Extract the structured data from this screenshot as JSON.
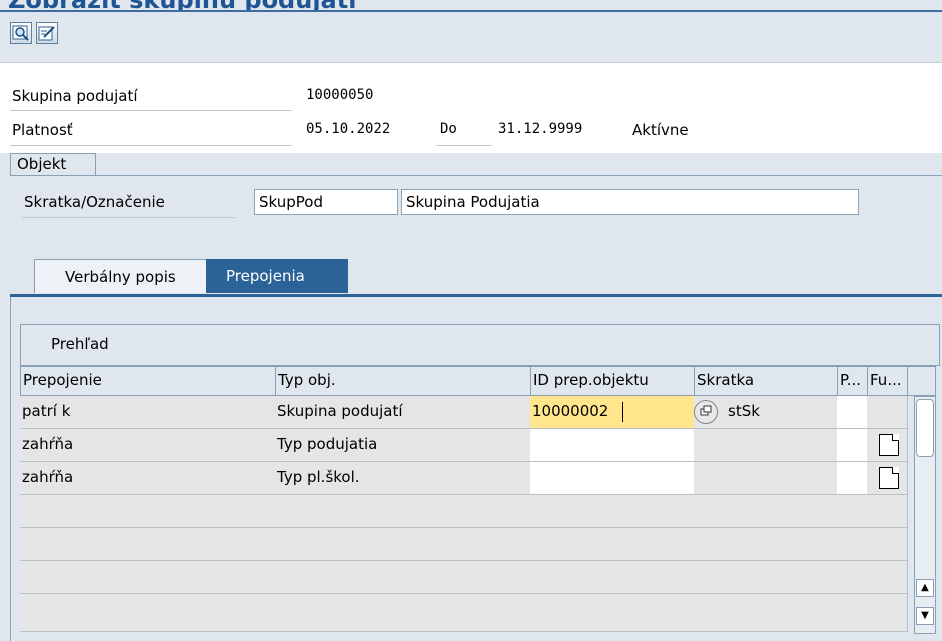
{
  "window": {
    "title": "Zobraziť skupinu podujatí"
  },
  "toolbar": {
    "icons": [
      "display-object-icon",
      "edit-object-icon"
    ]
  },
  "header": {
    "group_label": "Skupina podujatí",
    "group_value": "10000050",
    "validity_label": "Platnosť",
    "from_date": "05.10.2022",
    "to_label": "Do",
    "to_date": "31.12.9999",
    "status": "Aktívne"
  },
  "objekt": {
    "section_label": "Objekt",
    "field_label": "Skratka/Označenie",
    "short_value": "SkupPod",
    "long_value": "Skupina Podujatia"
  },
  "tabs": [
    {
      "label": "Verbálny popis"
    },
    {
      "label": "Prepojenia"
    }
  ],
  "grid": {
    "title": "Prehľad",
    "columns": [
      "Prepojenie",
      "Typ obj.",
      "ID prep.objektu",
      "Skratka",
      "P...",
      "Fu..."
    ],
    "rows": [
      {
        "rel": "patrí k",
        "type": "Skupina podujatí",
        "id": "10000002",
        "short": "stSk",
        "p": "",
        "fu": ""
      },
      {
        "rel": "zahŕňa",
        "type": "Typ podujatia",
        "id": "",
        "short": "",
        "p": "",
        "fu": ""
      },
      {
        "rel": "zahŕňa",
        "type": "Typ pl.škol.",
        "id": "",
        "short": "",
        "p": "",
        "fu": ""
      },
      {
        "rel": "",
        "type": "",
        "id": "",
        "short": "",
        "p": "",
        "fu": ""
      },
      {
        "rel": "",
        "type": "",
        "id": "",
        "short": "",
        "p": "",
        "fu": ""
      },
      {
        "rel": "",
        "type": "",
        "id": "",
        "short": "",
        "p": "",
        "fu": ""
      },
      {
        "rel": "",
        "type": "",
        "id": "",
        "short": "",
        "p": "",
        "fu": ""
      }
    ]
  },
  "colors": {
    "accent": "#2b6298",
    "focus": "#ffe68c",
    "background": "#dfe6ed"
  }
}
